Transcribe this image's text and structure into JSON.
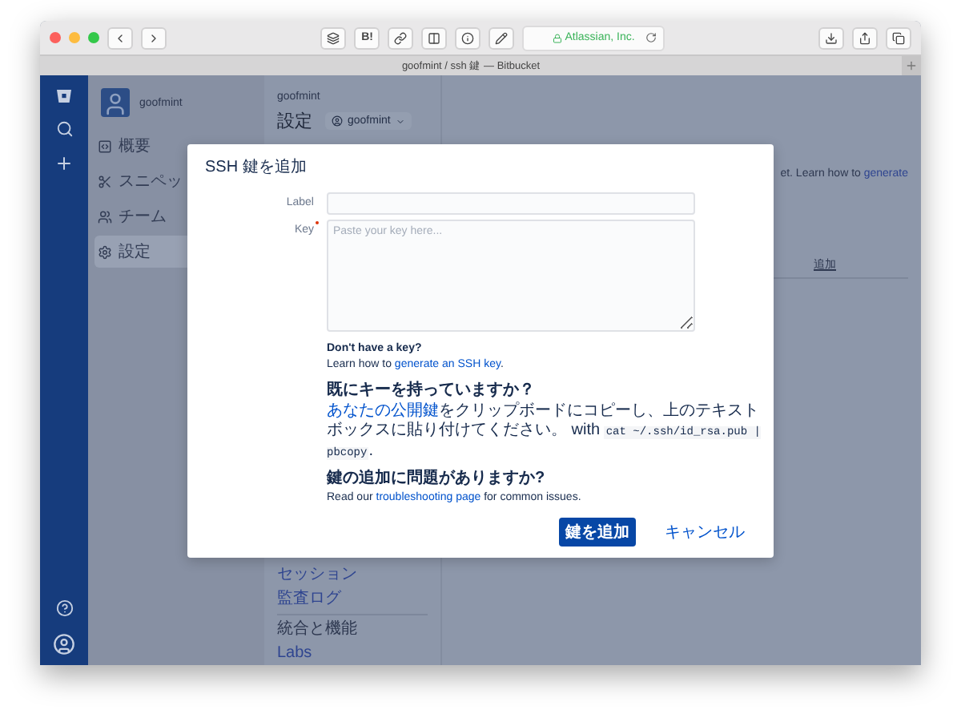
{
  "browser": {
    "toolbar_label": "B!",
    "address": "Atlassian, Inc.",
    "tab_title": "goofmint / ssh 鍵 — Bitbucket"
  },
  "nav": {
    "user": "goofmint",
    "items": [
      {
        "label": "概要",
        "kind": "code",
        "selected": false
      },
      {
        "label": "スニペッ",
        "kind": "scissors",
        "selected": false
      },
      {
        "label": "チーム",
        "kind": "team",
        "selected": false
      },
      {
        "label": "設定",
        "kind": "gear",
        "selected": true
      }
    ]
  },
  "main": {
    "owner": "goofmint",
    "title": "設定",
    "account": "goofmint",
    "intro_text": "et. Learn how to ",
    "intro_link": "generate",
    "table_header": "追加",
    "settings_items": [
      {
        "label": "セッション",
        "kind": "link"
      },
      {
        "label": "監査ログ",
        "kind": "link"
      },
      {
        "label": "統合と機能",
        "kind": "heading"
      },
      {
        "label": "Labs",
        "kind": "link"
      }
    ]
  },
  "dialog": {
    "title": "SSH 鍵を追加",
    "fields": [
      {
        "label": "Label",
        "kind": "input",
        "required": false
      },
      {
        "label": "Key",
        "kind": "textarea",
        "required": true,
        "placeholder": "Paste your key here..."
      }
    ],
    "help": [
      {
        "heading": "Don't have a key?",
        "parts": [
          {
            "kind": "text",
            "text": "Learn how to "
          },
          {
            "kind": "link",
            "text": "generate an SSH key"
          },
          {
            "kind": "text",
            "text": "."
          }
        ]
      },
      {
        "heading": "既にキーを持っていますか？",
        "parts": [
          {
            "kind": "link",
            "text": "あなたの公開鍵"
          },
          {
            "kind": "text",
            "text": "をクリップボードにコピーし、上のテキストボックスに貼り付けてください。 with "
          },
          {
            "kind": "code",
            "text": "cat ~/.ssh/id_rsa.pub | pbcopy"
          },
          {
            "kind": "text",
            "text": "."
          }
        ]
      },
      {
        "heading": "鍵の追加に問題がありますか?",
        "parts": [
          {
            "kind": "text",
            "text": "Read our "
          },
          {
            "kind": "link",
            "text": "troubleshooting page"
          },
          {
            "kind": "text",
            "text": " for common issues."
          }
        ]
      }
    ],
    "buttons": [
      {
        "label": "鍵を追加",
        "kind": "primary"
      },
      {
        "label": "キャンセル",
        "kind": "link"
      }
    ]
  }
}
